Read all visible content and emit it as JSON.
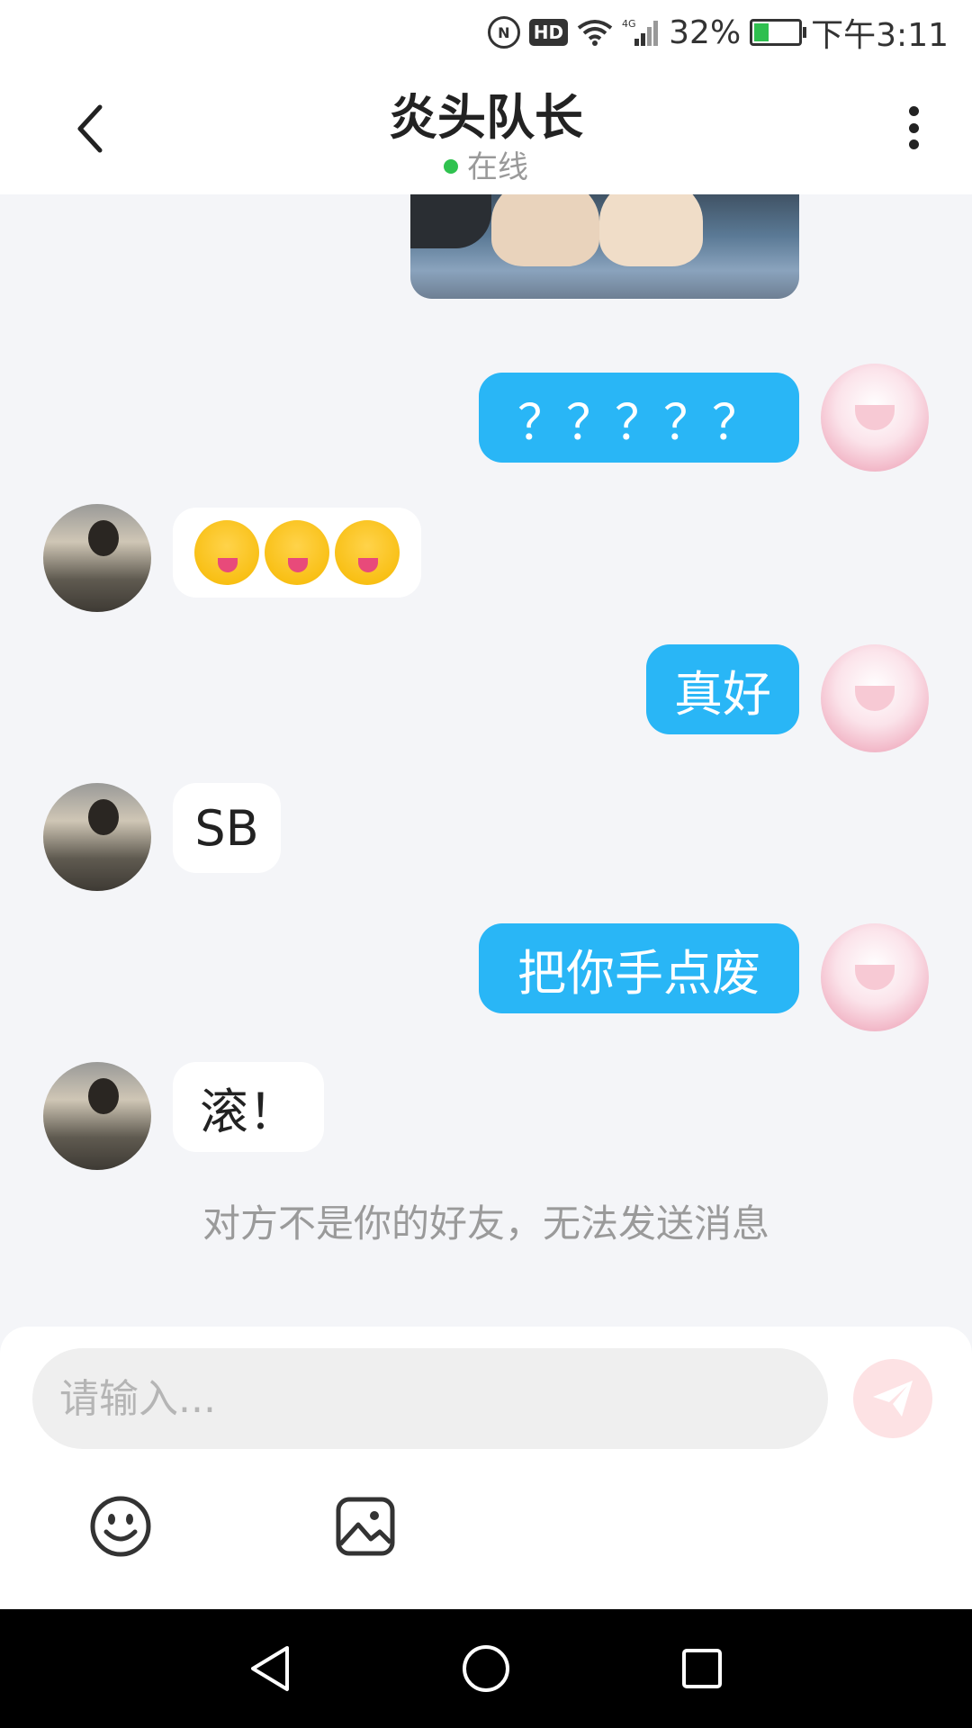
{
  "status_bar": {
    "nfc_icon": "nfc-icon",
    "hd_label": "HD",
    "network_label": "4G",
    "battery_text": "32%",
    "battery_level": 0.32,
    "time": "下午3:11"
  },
  "header": {
    "title": "炎头队长",
    "status": "在线",
    "status_color": "#2fc24f"
  },
  "messages": [
    {
      "from": "me",
      "type": "image",
      "content": "cat-photo"
    },
    {
      "from": "me",
      "type": "text",
      "text": "？？？？？"
    },
    {
      "from": "other",
      "type": "emoji",
      "emoji": "winking-tongue-face",
      "count": 3
    },
    {
      "from": "me",
      "type": "text",
      "text": "真好"
    },
    {
      "from": "other",
      "type": "text",
      "text": "SB"
    },
    {
      "from": "me",
      "type": "text",
      "text": "把你手点废"
    },
    {
      "from": "other",
      "type": "text",
      "text": "滚！"
    }
  ],
  "notice": "对方不是你的好友，无法发送消息",
  "composer": {
    "placeholder": "请输入...",
    "send_icon": "send-icon",
    "emoji_icon": "smiley-icon",
    "image_icon": "image-icon"
  },
  "colors": {
    "my_bubble": "#29b6f6",
    "other_bubble": "#ffffff",
    "background": "#f4f5f8"
  }
}
